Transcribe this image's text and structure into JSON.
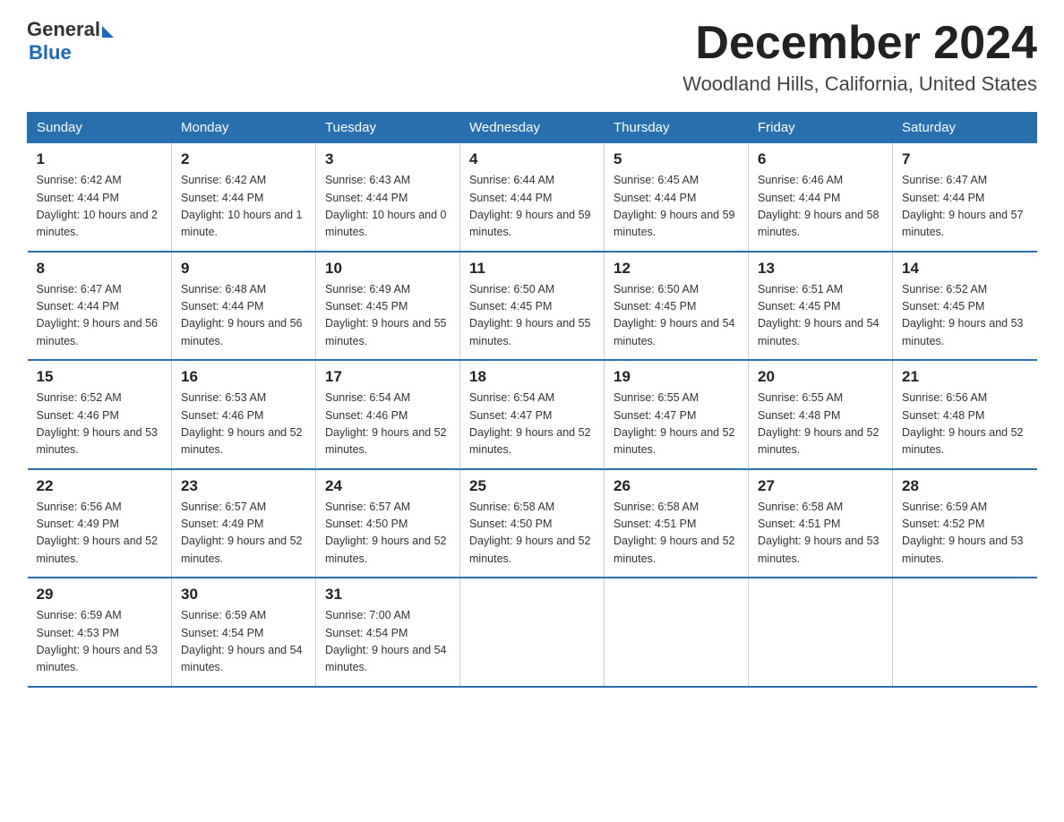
{
  "header": {
    "logo_general": "General",
    "logo_blue": "Blue",
    "month_title": "December 2024",
    "location": "Woodland Hills, California, United States"
  },
  "days_of_week": [
    "Sunday",
    "Monday",
    "Tuesday",
    "Wednesday",
    "Thursday",
    "Friday",
    "Saturday"
  ],
  "weeks": [
    [
      {
        "day": "1",
        "sunrise": "6:42 AM",
        "sunset": "4:44 PM",
        "daylight": "10 hours and 2 minutes."
      },
      {
        "day": "2",
        "sunrise": "6:42 AM",
        "sunset": "4:44 PM",
        "daylight": "10 hours and 1 minute."
      },
      {
        "day": "3",
        "sunrise": "6:43 AM",
        "sunset": "4:44 PM",
        "daylight": "10 hours and 0 minutes."
      },
      {
        "day": "4",
        "sunrise": "6:44 AM",
        "sunset": "4:44 PM",
        "daylight": "9 hours and 59 minutes."
      },
      {
        "day": "5",
        "sunrise": "6:45 AM",
        "sunset": "4:44 PM",
        "daylight": "9 hours and 59 minutes."
      },
      {
        "day": "6",
        "sunrise": "6:46 AM",
        "sunset": "4:44 PM",
        "daylight": "9 hours and 58 minutes."
      },
      {
        "day": "7",
        "sunrise": "6:47 AM",
        "sunset": "4:44 PM",
        "daylight": "9 hours and 57 minutes."
      }
    ],
    [
      {
        "day": "8",
        "sunrise": "6:47 AM",
        "sunset": "4:44 PM",
        "daylight": "9 hours and 56 minutes."
      },
      {
        "day": "9",
        "sunrise": "6:48 AM",
        "sunset": "4:44 PM",
        "daylight": "9 hours and 56 minutes."
      },
      {
        "day": "10",
        "sunrise": "6:49 AM",
        "sunset": "4:45 PM",
        "daylight": "9 hours and 55 minutes."
      },
      {
        "day": "11",
        "sunrise": "6:50 AM",
        "sunset": "4:45 PM",
        "daylight": "9 hours and 55 minutes."
      },
      {
        "day": "12",
        "sunrise": "6:50 AM",
        "sunset": "4:45 PM",
        "daylight": "9 hours and 54 minutes."
      },
      {
        "day": "13",
        "sunrise": "6:51 AM",
        "sunset": "4:45 PM",
        "daylight": "9 hours and 54 minutes."
      },
      {
        "day": "14",
        "sunrise": "6:52 AM",
        "sunset": "4:45 PM",
        "daylight": "9 hours and 53 minutes."
      }
    ],
    [
      {
        "day": "15",
        "sunrise": "6:52 AM",
        "sunset": "4:46 PM",
        "daylight": "9 hours and 53 minutes."
      },
      {
        "day": "16",
        "sunrise": "6:53 AM",
        "sunset": "4:46 PM",
        "daylight": "9 hours and 52 minutes."
      },
      {
        "day": "17",
        "sunrise": "6:54 AM",
        "sunset": "4:46 PM",
        "daylight": "9 hours and 52 minutes."
      },
      {
        "day": "18",
        "sunrise": "6:54 AM",
        "sunset": "4:47 PM",
        "daylight": "9 hours and 52 minutes."
      },
      {
        "day": "19",
        "sunrise": "6:55 AM",
        "sunset": "4:47 PM",
        "daylight": "9 hours and 52 minutes."
      },
      {
        "day": "20",
        "sunrise": "6:55 AM",
        "sunset": "4:48 PM",
        "daylight": "9 hours and 52 minutes."
      },
      {
        "day": "21",
        "sunrise": "6:56 AM",
        "sunset": "4:48 PM",
        "daylight": "9 hours and 52 minutes."
      }
    ],
    [
      {
        "day": "22",
        "sunrise": "6:56 AM",
        "sunset": "4:49 PM",
        "daylight": "9 hours and 52 minutes."
      },
      {
        "day": "23",
        "sunrise": "6:57 AM",
        "sunset": "4:49 PM",
        "daylight": "9 hours and 52 minutes."
      },
      {
        "day": "24",
        "sunrise": "6:57 AM",
        "sunset": "4:50 PM",
        "daylight": "9 hours and 52 minutes."
      },
      {
        "day": "25",
        "sunrise": "6:58 AM",
        "sunset": "4:50 PM",
        "daylight": "9 hours and 52 minutes."
      },
      {
        "day": "26",
        "sunrise": "6:58 AM",
        "sunset": "4:51 PM",
        "daylight": "9 hours and 52 minutes."
      },
      {
        "day": "27",
        "sunrise": "6:58 AM",
        "sunset": "4:51 PM",
        "daylight": "9 hours and 53 minutes."
      },
      {
        "day": "28",
        "sunrise": "6:59 AM",
        "sunset": "4:52 PM",
        "daylight": "9 hours and 53 minutes."
      }
    ],
    [
      {
        "day": "29",
        "sunrise": "6:59 AM",
        "sunset": "4:53 PM",
        "daylight": "9 hours and 53 minutes."
      },
      {
        "day": "30",
        "sunrise": "6:59 AM",
        "sunset": "4:54 PM",
        "daylight": "9 hours and 54 minutes."
      },
      {
        "day": "31",
        "sunrise": "7:00 AM",
        "sunset": "4:54 PM",
        "daylight": "9 hours and 54 minutes."
      },
      null,
      null,
      null,
      null
    ]
  ]
}
